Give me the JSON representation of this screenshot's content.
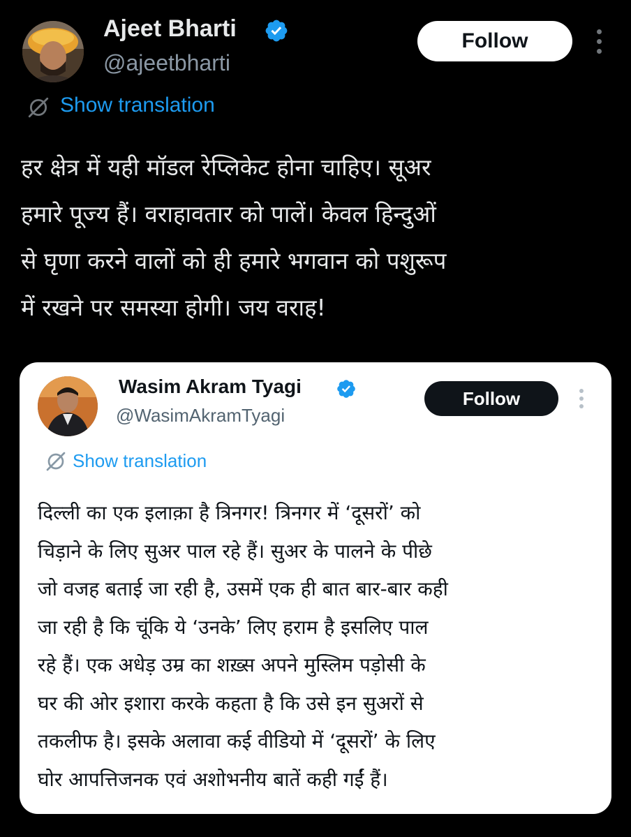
{
  "tweet": {
    "author": {
      "name": "Ajeet Bharti",
      "handle": "@ajeetbharti",
      "verified": true,
      "avatar_icon": "avatar-man-orange-turban"
    },
    "follow_label": "Follow",
    "more_icon": "more-vertical-icon",
    "translate_icon": "translate-globe-icon",
    "translate_label": "Show translation",
    "text_lines": [
      "हर क्षेत्र में यही मॉडल रेप्लिकेट होना चाहिए। सूअर",
      "हमारे पूज्य हैं। वराहावतार को पालें। केवल हिन्दुओं",
      "से घृणा करने वालों को ही हमारे भगवान को पशुरूप",
      "में रखने पर समस्या होगी। जय वराह!"
    ],
    "colors": {
      "background": "#000000",
      "text": "#e7e9ea",
      "secondary": "#8b98a5",
      "accent": "#1d9bf0"
    }
  },
  "quoted_tweet": {
    "author": {
      "name": "Wasim Akram Tyagi",
      "handle": "@WasimAkramTyagi",
      "verified": true,
      "avatar_icon": "avatar-man-dark-jacket"
    },
    "follow_label": "Follow",
    "more_icon": "more-vertical-icon",
    "translate_icon": "translate-globe-icon",
    "translate_label": "Show translation",
    "text_lines": [
      "दिल्ली का एक इलाक़ा है त्रिनगर! त्रिनगर में ‘दूसरों’ को",
      "चिड़ाने के लिए सुअर पाल रहे हैं। सुअर के पालने के पीछे",
      "जो वजह बताई जा रही है, उसमें एक ही बात बार-बार कही",
      "जा रही है कि चूंकि ये ‘उनके’ लिए हराम है इसलिए पाल",
      "रहे हैं। एक अधेड़ उम्र का शख़्स अपने मुस्लिम पड़ोसी के",
      "घर की ओर इशारा करके कहता है कि उसे इन सुअरों से",
      "तकलीफ है। इसके अलावा कई वीडियो में ‘दूसरों’ के लिए",
      "घोर आपत्तिजनक एवं अशोभनीय बातें कही गईं हैं।"
    ],
    "colors": {
      "card_background": "#ffffff",
      "text": "#0f1419",
      "secondary": "#536471"
    }
  }
}
